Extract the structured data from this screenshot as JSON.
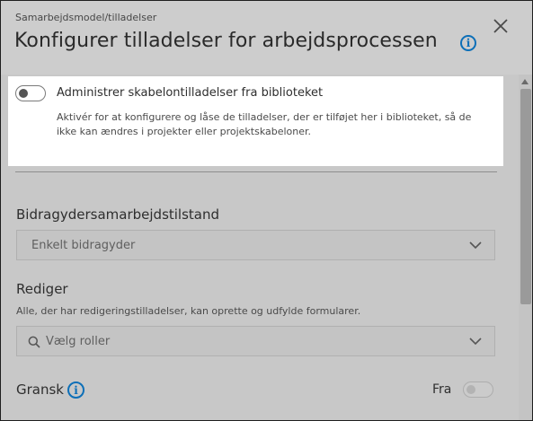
{
  "header": {
    "breadcrumb": "Samarbejdsmodel/tilladelser",
    "title": "Konfigurer tilladelser for arbejdsprocessen",
    "icons": {
      "info": "info-icon",
      "close": "close-icon"
    }
  },
  "library_toggle": {
    "label": "Administrer skabelontilladelser fra biblioteket",
    "description": "Aktivér for at konfigurere og låse de tilladelser, der er tilføjet her i biblioteket, så de ikke kan ændres i projekter eller projektskabeloner.",
    "enabled": false
  },
  "contributor": {
    "label": "Bidragydersamarbejdstilstand",
    "selected": "Enkelt bidragyder"
  },
  "edit": {
    "label": "Rediger",
    "helper": "Alle, der har redigeringstilladelser, kan oprette og udfylde formularer.",
    "placeholder": "Vælg roller"
  },
  "review": {
    "label": "Gransk",
    "toggle_text": "Fra",
    "enabled": false
  },
  "colors": {
    "accent": "#0c6fb8",
    "overlay": "#c8c8c8",
    "highlight": "#ffffff"
  }
}
